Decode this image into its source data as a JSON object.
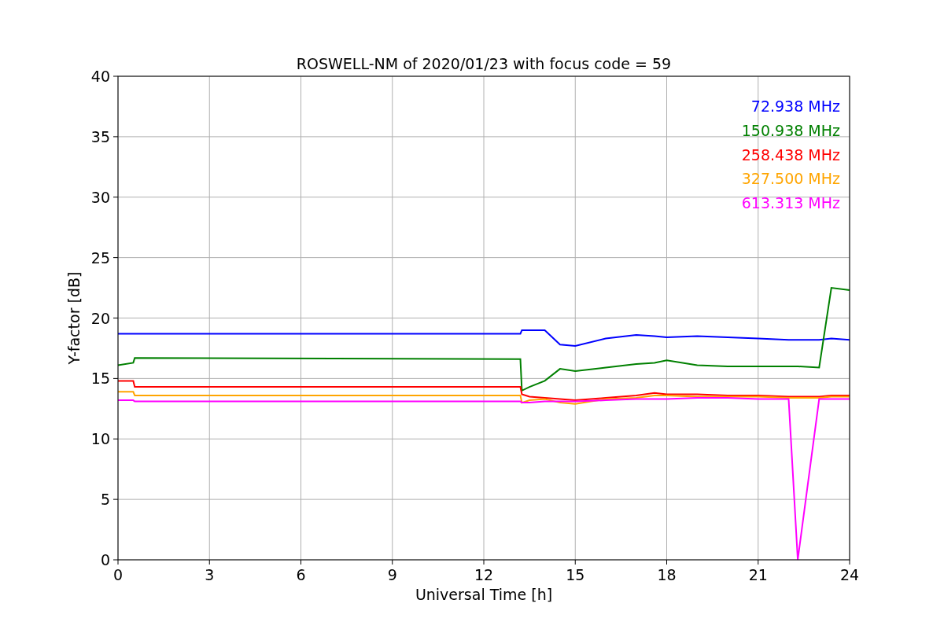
{
  "chart_data": {
    "type": "line",
    "title": "ROSWELL-NM of 2020/01/23 with focus code = 59",
    "xlabel": "Universal Time [h]",
    "ylabel": "Y-factor [dB]",
    "x": [
      0,
      0.5,
      0.55,
      13.2,
      13.25,
      13.5,
      14,
      14.5,
      15,
      16,
      17,
      17.6,
      18,
      19,
      20,
      21,
      22,
      22.3,
      23,
      23.4,
      24
    ],
    "series": [
      {
        "name": "72.938 MHz",
        "color": "#0000ff",
        "values": [
          18.7,
          18.7,
          18.7,
          18.7,
          19,
          19,
          19,
          17.8,
          17.7,
          18.3,
          18.6,
          18.5,
          18.4,
          18.5,
          18.4,
          18.3,
          18.2,
          18.2,
          18.2,
          18.3,
          18.2
        ]
      },
      {
        "name": "150.938 MHz",
        "color": "#008000",
        "values": [
          16.1,
          16.3,
          16.7,
          16.6,
          14,
          14.3,
          14.8,
          15.8,
          15.6,
          15.9,
          16.2,
          16.3,
          16.5,
          16.1,
          16,
          16,
          16,
          16,
          15.9,
          22.5,
          22.3
        ]
      },
      {
        "name": "258.438 MHz",
        "color": "#ff0000",
        "values": [
          14.8,
          14.8,
          14.3,
          14.3,
          13.7,
          13.5,
          13.4,
          13.3,
          13.2,
          13.4,
          13.6,
          13.8,
          13.7,
          13.7,
          13.6,
          13.6,
          13.5,
          13.5,
          13.5,
          13.6,
          13.6
        ]
      },
      {
        "name": "327.500 MHz",
        "color": "#ffa500",
        "values": [
          13.9,
          13.9,
          13.6,
          13.6,
          13,
          13.2,
          13.3,
          13,
          12.9,
          13.3,
          13.4,
          13.6,
          13.6,
          13.5,
          13.5,
          13.5,
          13.4,
          13.4,
          13.4,
          13.5,
          13.5
        ]
      },
      {
        "name": "613.313 MHz",
        "color": "#ff00ff",
        "values": [
          13.2,
          13.2,
          13.1,
          13.1,
          13,
          13,
          13.1,
          13.1,
          13.1,
          13.2,
          13.3,
          13.3,
          13.3,
          13.4,
          13.4,
          13.3,
          13.3,
          0,
          13.3,
          13.3,
          13.3
        ]
      }
    ],
    "grid": true,
    "xlim": [
      0,
      24
    ],
    "ylim": [
      0,
      40
    ],
    "xticks": [
      0,
      3,
      6,
      9,
      12,
      15,
      18,
      21,
      24
    ],
    "yticks": [
      0,
      5,
      10,
      15,
      20,
      25,
      30,
      35,
      40
    ]
  }
}
